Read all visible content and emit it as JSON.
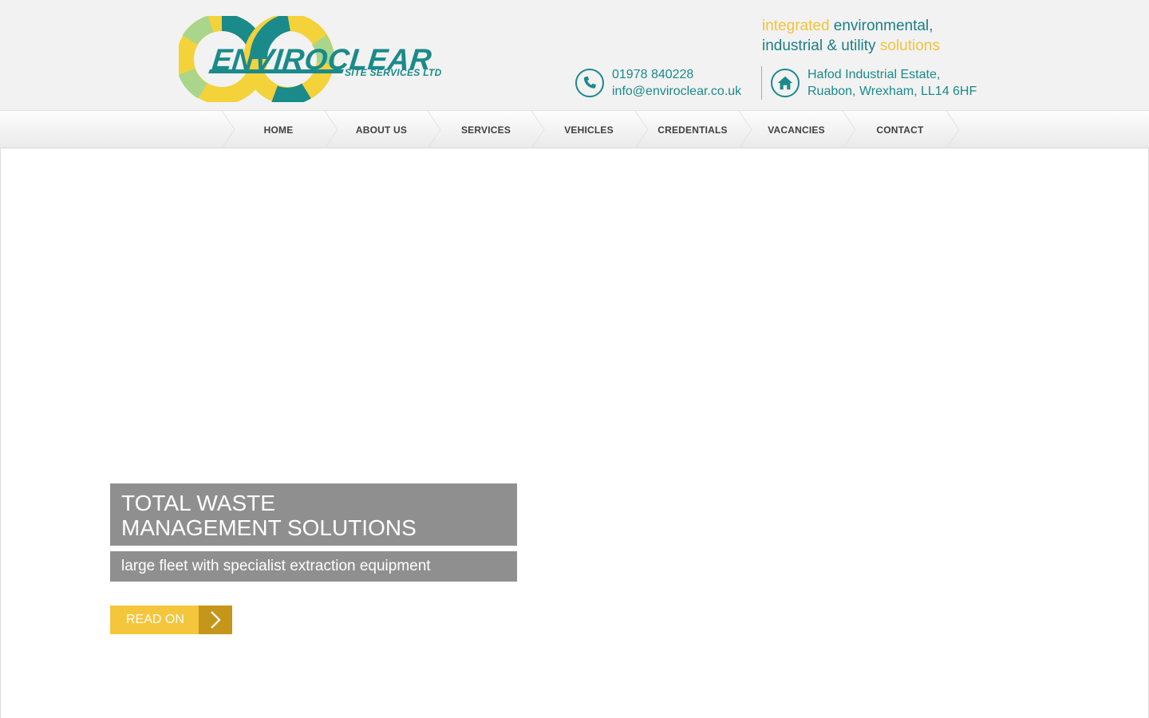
{
  "logo": {
    "name": "ENVIROCLEAR",
    "subtitle": "SITE SERVICES LTD",
    "colors": {
      "teal": "#1b8a8a",
      "yellow": "#f3d23a",
      "green": "#a9d68a"
    }
  },
  "tagline": {
    "part1": "integrated",
    "part2": "environmental,",
    "part3": "industrial & utility",
    "part4": "solutions"
  },
  "contact": {
    "phone": "01978 840228",
    "email": "info@enviroclear.co.uk",
    "phone_icon": "phone-icon",
    "address_line1": "Hafod Industrial Estate,",
    "address_line2": "Ruabon, Wrexham, LL14 6HF",
    "address_icon": "home-icon"
  },
  "nav": {
    "items": [
      {
        "label": "HOME"
      },
      {
        "label": "ABOUT US"
      },
      {
        "label": "SERVICES"
      },
      {
        "label": "VEHICLES"
      },
      {
        "label": "CREDENTIALS"
      },
      {
        "label": "VACANCIES"
      },
      {
        "label": "CONTACT"
      }
    ]
  },
  "hero": {
    "title_line1": "TOTAL WASTE",
    "title_line2": "MANAGEMENT SOLUTIONS",
    "subtitle": "large fleet with specialist extraction equipment",
    "button_label": "READ ON",
    "button_icon": "chevron-right-icon"
  },
  "colors": {
    "accent_teal": "#1b8a8a",
    "accent_yellow": "#f3c33a",
    "button_dark_yellow": "#c4961a",
    "caption_gray": "#8f8f8f"
  }
}
